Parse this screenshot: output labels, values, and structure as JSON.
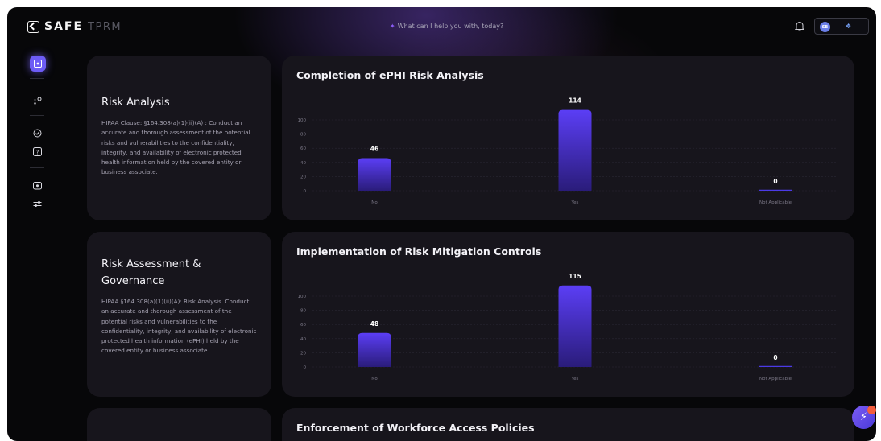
{
  "app": {
    "brand": "SAFE",
    "brand_sub": "TPRM",
    "search_placeholder": "What can I help you with, today?",
    "search_icon": "sparkle-icon",
    "notification_icon": "bell-icon",
    "avatar_initials": "SB",
    "org_icon": "org-logo-icon",
    "accent": "#6d5cf6",
    "bar_color_top": "#5b3ef5",
    "bar_color_bottom": "#2a1c7a"
  },
  "sidebar": {
    "items": [
      {
        "icon": "dashboard-icon",
        "active": true
      },
      {
        "icon": "connections-icon",
        "active": false
      },
      {
        "icon": "shield-check-icon",
        "active": false
      },
      {
        "icon": "help-icon",
        "active": false
      },
      {
        "icon": "vault-icon",
        "active": false
      },
      {
        "icon": "settings-sliders-icon",
        "active": false
      }
    ]
  },
  "sections": [
    {
      "title": "Risk Analysis",
      "description": "HIPAA Clause: §164.308(a)(1)(ii)(A) : Conduct an accurate and thorough assessment of the potential risks and vulnerabilities to the confidentiality, integrity, and availability of electronic protected health information held by the covered entity or business associate.",
      "chart_title": "Completion of ePHI Risk Analysis"
    },
    {
      "title": "Risk Assessment & Governance",
      "description": "HIPAA §164.308(a)(1)(ii)(A): Risk Analysis. Conduct an accurate and thorough assessment of the potential risks and vulnerabilities to the confidentiality, integrity, and availability of electronic protected health information (ePHI) held by the covered entity or business associate.",
      "chart_title": "Implementation of Risk Mitigation Controls"
    },
    {
      "title": "",
      "description": "",
      "chart_title": "Enforcement of Workforce Access Policies"
    }
  ],
  "chart_data": [
    {
      "type": "bar",
      "title": "Completion of ePHI Risk Analysis",
      "categories": [
        "No",
        "Yes",
        "Not Applicable"
      ],
      "values": [
        46,
        114,
        0
      ],
      "yticks": [
        0,
        20,
        40,
        60,
        80,
        100
      ],
      "ylim": [
        0,
        120
      ],
      "grid": true
    },
    {
      "type": "bar",
      "title": "Implementation of Risk Mitigation Controls",
      "categories": [
        "No",
        "Yes",
        "Not Applicable"
      ],
      "values": [
        48,
        115,
        0
      ],
      "yticks": [
        0,
        20,
        40,
        60,
        80,
        100
      ],
      "ylim": [
        0,
        120
      ],
      "grid": true
    }
  ],
  "fab": {
    "icon": "chat-bolt-icon"
  }
}
